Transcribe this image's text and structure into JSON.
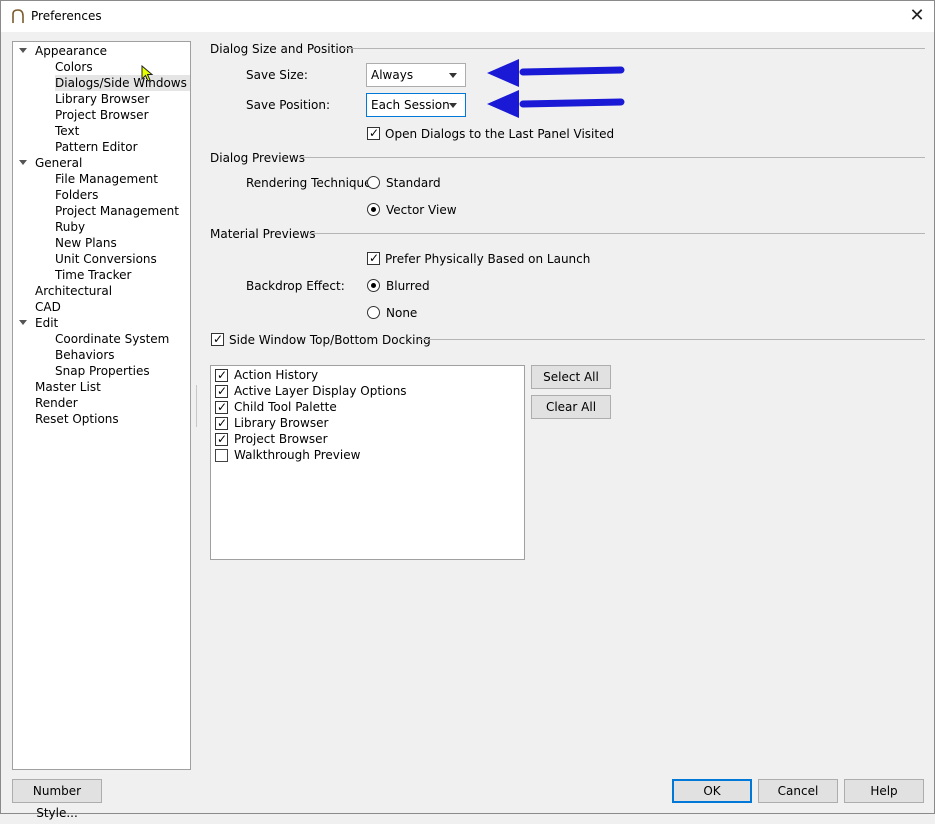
{
  "window": {
    "title": "Preferences",
    "close_glyph": "✕"
  },
  "tree": {
    "items": [
      {
        "label": "Appearance",
        "level": 0,
        "expanded": true
      },
      {
        "label": "Colors",
        "level": 1
      },
      {
        "label": "Dialogs/Side Windows",
        "level": 1,
        "selected": true
      },
      {
        "label": "Library Browser",
        "level": 1
      },
      {
        "label": "Project Browser",
        "level": 1
      },
      {
        "label": "Text",
        "level": 1
      },
      {
        "label": "Pattern Editor",
        "level": 1
      },
      {
        "label": "General",
        "level": 0,
        "expanded": true
      },
      {
        "label": "File Management",
        "level": 1
      },
      {
        "label": "Folders",
        "level": 1
      },
      {
        "label": "Project Management",
        "level": 1
      },
      {
        "label": "Ruby",
        "level": 1
      },
      {
        "label": "New Plans",
        "level": 1
      },
      {
        "label": "Unit Conversions",
        "level": 1
      },
      {
        "label": "Time Tracker",
        "level": 1
      },
      {
        "label": "Architectural",
        "level": 0
      },
      {
        "label": "CAD",
        "level": 0
      },
      {
        "label": "Edit",
        "level": 0,
        "expanded": true
      },
      {
        "label": "Coordinate System",
        "level": 1
      },
      {
        "label": "Behaviors",
        "level": 1
      },
      {
        "label": "Snap Properties",
        "level": 1
      },
      {
        "label": "Master List",
        "level": 0
      },
      {
        "label": "Render",
        "level": 0
      },
      {
        "label": "Reset Options",
        "level": 0
      }
    ]
  },
  "dialog_size": {
    "header": "Dialog Size and Position",
    "save_size_label": "Save Size:",
    "save_size_value": "Always",
    "save_position_label": "Save Position:",
    "save_position_value": "Each Session",
    "open_last_panel_label": "Open Dialogs to the Last Panel Visited",
    "open_last_panel_checked": true
  },
  "dialog_previews": {
    "header": "Dialog Previews",
    "rendering_label": "Rendering Technique:",
    "standard_label": "Standard",
    "vector_label": "Vector View",
    "selected": "Vector View"
  },
  "material_previews": {
    "header": "Material Previews",
    "pbr_label": "Prefer Physically Based on Launch",
    "pbr_checked": true,
    "backdrop_label": "Backdrop Effect:",
    "blurred_label": "Blurred",
    "none_label": "None",
    "selected": "Blurred"
  },
  "docking": {
    "label": "Side Window Top/Bottom Docking",
    "checked": true,
    "items": [
      {
        "label": "Action History",
        "checked": true
      },
      {
        "label": "Active Layer Display Options",
        "checked": true
      },
      {
        "label": "Child Tool Palette",
        "checked": true
      },
      {
        "label": "Library Browser",
        "checked": true
      },
      {
        "label": "Project Browser",
        "checked": true
      },
      {
        "label": "Walkthrough Preview",
        "checked": false
      }
    ],
    "select_all_label": "Select All",
    "clear_all_label": "Clear All"
  },
  "footer": {
    "number_style_label": "Number Style...",
    "ok_label": "OK",
    "cancel_label": "Cancel",
    "help_label": "Help"
  },
  "colors": {
    "annotation_arrow": "#1a1ad6",
    "focus": "#0078d7"
  }
}
